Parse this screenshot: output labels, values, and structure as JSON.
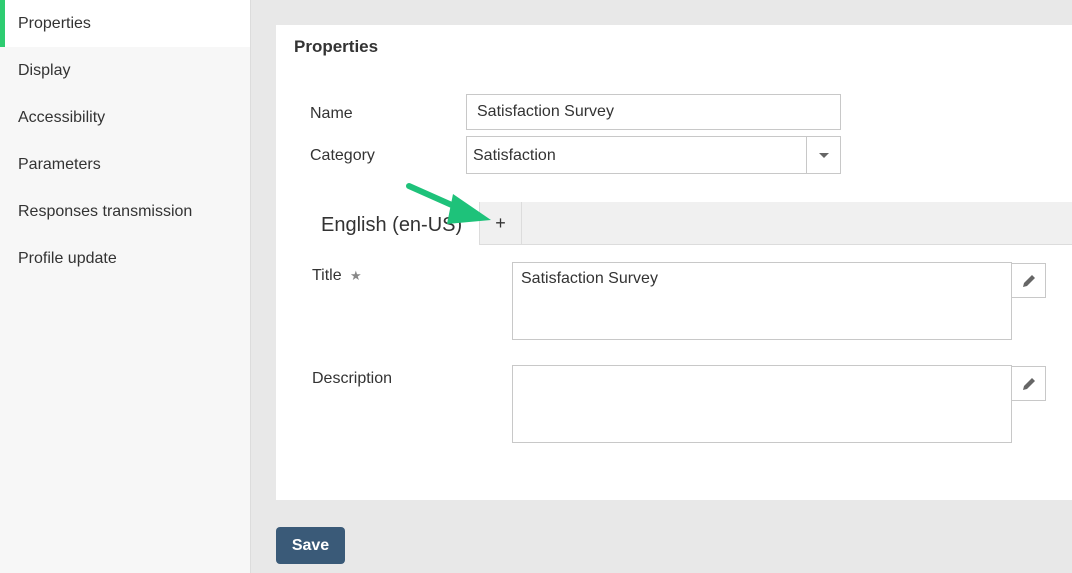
{
  "sidebar": {
    "items": [
      {
        "label": "Properties"
      },
      {
        "label": "Display"
      },
      {
        "label": "Accessibility"
      },
      {
        "label": "Parameters"
      },
      {
        "label": "Responses transmission"
      },
      {
        "label": "Profile update"
      }
    ],
    "active_index": 0,
    "accent_color": "#2ecc71"
  },
  "panel": {
    "title": "Properties",
    "name_label": "Name",
    "name_value": "Satisfaction Survey",
    "category_label": "Category",
    "category_value": "Satisfaction",
    "tabs": {
      "active_label": "English (en-US)",
      "add_label": "+"
    },
    "title_label": "Title",
    "title_required_icon": "star-icon",
    "title_value": "Satisfaction Survey",
    "description_label": "Description",
    "description_value": ""
  },
  "actions": {
    "save_label": "Save",
    "save_color": "#3a5a78"
  },
  "annotation": {
    "arrow_color": "#1ec27a",
    "arrow_icon": "arrow-pointer-icon"
  }
}
